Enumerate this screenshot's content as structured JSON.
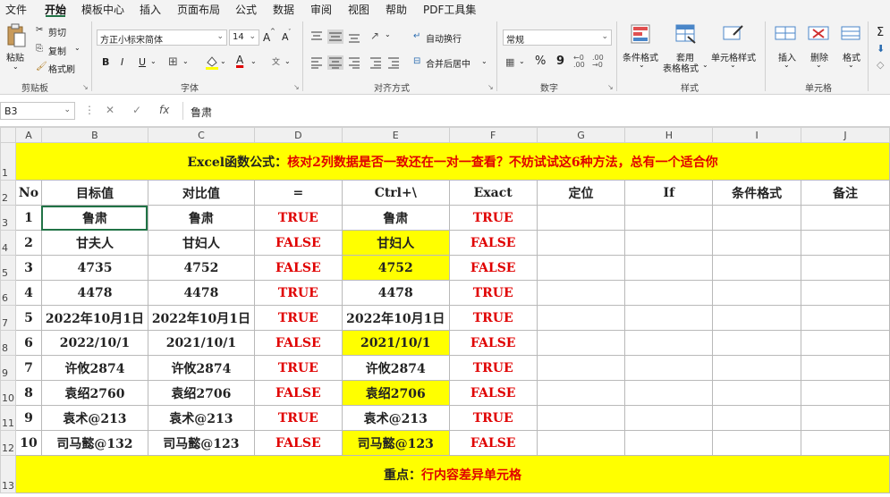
{
  "menu": {
    "tabs": [
      "文件",
      "开始",
      "模板中心",
      "插入",
      "页面布局",
      "公式",
      "数据",
      "审阅",
      "视图",
      "帮助",
      "PDF工具集"
    ],
    "active": "开始"
  },
  "ribbon": {
    "clipboard": {
      "paste": "粘贴",
      "cut": "剪切",
      "copy": "复制",
      "format_painter": "格式刷",
      "label": "剪贴板"
    },
    "font": {
      "name": "方正小标宋简体",
      "size": "14",
      "grow": "A",
      "shrink": "A",
      "bold": "B",
      "italic": "I",
      "underline": "U",
      "font_color": "A",
      "phonetic": "文",
      "label": "字体"
    },
    "alignment": {
      "wrap_text": "自动换行",
      "merge_center": "合并后居中",
      "label": "对齐方式"
    },
    "number": {
      "format": "常规",
      "percent": "%",
      "comma": "9",
      "label": "数字"
    },
    "styles": {
      "conditional": "条件格式",
      "format_table_1": "套用",
      "format_table_2": "表格格式",
      "cell_styles": "单元格样式",
      "label": "样式"
    },
    "cells": {
      "insert": "插入",
      "delete": "删除",
      "format": "格式",
      "label": "单元格"
    }
  },
  "formula_bar": {
    "name_box": "B3",
    "fx": "fx",
    "value": "鲁肃"
  },
  "sheet": {
    "columns": [
      "A",
      "B",
      "C",
      "D",
      "E",
      "F",
      "G",
      "H",
      "I",
      "J"
    ],
    "row_numbers": [
      "1",
      "2",
      "3",
      "4",
      "5",
      "6",
      "7",
      "8",
      "9",
      "10",
      "11",
      "12",
      "13"
    ],
    "title_black": "Excel函数公式：",
    "title_red": "核对2列数据是否一致还在一对一查看？不妨试试这6种方法，总有一个适合你",
    "headers": [
      "No",
      "目标值",
      "对比值",
      "=",
      "Ctrl+\\",
      "Exact",
      "定位",
      "If",
      "条件格式",
      "备注"
    ],
    "rows": [
      {
        "no": "1",
        "target": "鲁肃",
        "compare": "鲁肃",
        "eq": "TRUE",
        "ctrl": "鲁肃",
        "exact": "TRUE",
        "diff": false
      },
      {
        "no": "2",
        "target": "甘夫人",
        "compare": "甘妇人",
        "eq": "FALSE",
        "ctrl": "甘妇人",
        "exact": "FALSE",
        "diff": true
      },
      {
        "no": "3",
        "target": "4735",
        "compare": "4752",
        "eq": "FALSE",
        "ctrl": "4752",
        "exact": "FALSE",
        "diff": true
      },
      {
        "no": "4",
        "target": "4478",
        "compare": "4478",
        "eq": "TRUE",
        "ctrl": "4478",
        "exact": "TRUE",
        "diff": false
      },
      {
        "no": "5",
        "target": "2022年10月1日",
        "compare": "2022年10月1日",
        "eq": "TRUE",
        "ctrl": "2022年10月1日",
        "exact": "TRUE",
        "diff": false
      },
      {
        "no": "6",
        "target": "2022/10/1",
        "compare": "2021/10/1",
        "eq": "FALSE",
        "ctrl": "2021/10/1",
        "exact": "FALSE",
        "diff": true
      },
      {
        "no": "7",
        "target": "许攸2874",
        "compare": "许攸2874",
        "eq": "TRUE",
        "ctrl": "许攸2874",
        "exact": "TRUE",
        "diff": false
      },
      {
        "no": "8",
        "target": "袁绍2760",
        "compare": "袁绍2706",
        "eq": "FALSE",
        "ctrl": "袁绍2706",
        "exact": "FALSE",
        "diff": true
      },
      {
        "no": "9",
        "target": "袁术@213",
        "compare": "袁术@213",
        "eq": "TRUE",
        "ctrl": "袁术@213",
        "exact": "TRUE",
        "diff": false
      },
      {
        "no": "10",
        "target": "司马懿@132",
        "compare": "司马懿@123",
        "eq": "FALSE",
        "ctrl": "司马懿@123",
        "exact": "FALSE",
        "diff": true
      }
    ],
    "footer_black": "重点：",
    "footer_red": "行内容差异单元格"
  },
  "colors": {
    "highlight": "#ffff00",
    "false_text": "#e00000",
    "accent": "#217346"
  }
}
